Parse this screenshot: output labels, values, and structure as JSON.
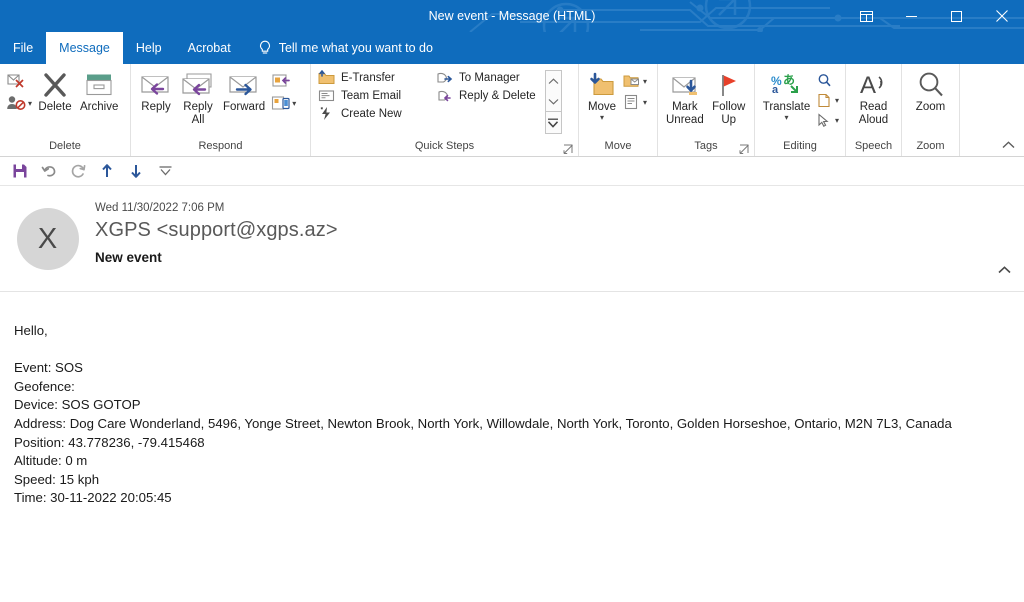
{
  "window": {
    "title": "New event  -  Message (HTML)",
    "controls": {
      "ribbon_display": "ribbon-display-options",
      "minimize": "Minimize",
      "maximize": "Maximize",
      "close": "Close"
    }
  },
  "tabs": [
    {
      "label": "File",
      "active": false
    },
    {
      "label": "Message",
      "active": true
    },
    {
      "label": "Help",
      "active": false
    },
    {
      "label": "Acrobat",
      "active": false
    }
  ],
  "tellme": {
    "label": "Tell me what you want to do",
    "icon": "lightbulb-icon"
  },
  "ribbon": {
    "collapse_icon": "chevron-up-icon",
    "groups": [
      {
        "name": "Delete",
        "label": "Delete",
        "micro": [
          {
            "label": "Ignore",
            "icon": "ignore-icon"
          },
          {
            "label": "Junk",
            "icon": "junk-icon"
          }
        ],
        "buttons": [
          {
            "label": "Delete",
            "icon": "delete-x-icon"
          },
          {
            "label": "Archive",
            "icon": "archive-icon"
          }
        ]
      },
      {
        "name": "Respond",
        "label": "Respond",
        "buttons": [
          {
            "label": "Reply",
            "icon": "reply-icon"
          },
          {
            "label": "Reply\nAll",
            "icon": "reply-all-icon"
          },
          {
            "label": "Forward",
            "icon": "forward-icon"
          }
        ],
        "stack": [
          {
            "label": "Meeting",
            "icon": "meeting-icon"
          },
          {
            "label": "More",
            "icon": "more-respond-icon"
          }
        ]
      },
      {
        "name": "Quick Steps",
        "label": "Quick Steps",
        "launcher": "dialog-launcher-icon",
        "items_col1": [
          {
            "label": "E-Transfer",
            "icon": "folder-move-icon"
          },
          {
            "label": "Team Email",
            "icon": "team-email-icon"
          },
          {
            "label": "Create New",
            "icon": "create-new-icon"
          }
        ],
        "items_col2": [
          {
            "label": "To Manager",
            "icon": "to-manager-icon"
          },
          {
            "label": "Reply & Delete",
            "icon": "reply-delete-icon"
          }
        ],
        "scroll": {
          "up": "scroll-up-icon",
          "down": "scroll-down-icon",
          "more": "quick-steps-more-icon"
        }
      },
      {
        "name": "Move",
        "label": "Move",
        "buttons": [
          {
            "label": "Move",
            "icon": "move-folder-icon"
          }
        ],
        "stack": [
          {
            "label": "Rules",
            "icon": "rules-icon"
          },
          {
            "label": "OneNote",
            "icon": "onenote-icon"
          }
        ]
      },
      {
        "name": "Tags",
        "label": "Tags",
        "launcher": "dialog-launcher-icon",
        "buttons": [
          {
            "label": "Mark\nUnread",
            "icon": "mark-unread-icon"
          },
          {
            "label": "Follow\nUp",
            "icon": "follow-up-flag-icon"
          }
        ]
      },
      {
        "name": "Editing",
        "label": "Editing",
        "buttons": [
          {
            "label": "Translate",
            "icon": "translate-icon"
          }
        ],
        "stack": [
          {
            "label": "Find",
            "icon": "find-magnifier-icon"
          },
          {
            "label": "Select All",
            "icon": "select-page-icon"
          },
          {
            "label": "Select",
            "icon": "select-pointer-icon"
          }
        ]
      },
      {
        "name": "Speech",
        "label": "Speech",
        "buttons": [
          {
            "label": "Read\nAloud",
            "icon": "read-aloud-icon"
          }
        ]
      },
      {
        "name": "Zoom",
        "label": "Zoom",
        "buttons": [
          {
            "label": "Zoom",
            "icon": "zoom-magnifier-icon"
          }
        ]
      }
    ]
  },
  "quick_access": [
    {
      "name": "save",
      "icon": "save-floppy-icon"
    },
    {
      "name": "undo",
      "icon": "undo-arrow-icon"
    },
    {
      "name": "redo",
      "icon": "redo-arrow-icon"
    },
    {
      "name": "previous-item",
      "icon": "arrow-up-icon"
    },
    {
      "name": "next-item",
      "icon": "arrow-down-icon"
    },
    {
      "name": "customize",
      "icon": "customize-qat-icon"
    }
  ],
  "message": {
    "avatar_initial": "X",
    "date": "Wed 11/30/2022 7:06 PM",
    "from": "XGPS <support@xgps.az>",
    "subject": "New event",
    "expand_icon": "chevron-up-icon",
    "body": [
      "Hello,",
      "",
      "Event: SOS",
      "Geofence:",
      "Device: SOS GOTOP",
      "Address: Dog Care Wonderland, 5496, Yonge Street, Newton Brook, North York, Willowdale, North York, Toronto, Golden Horseshoe, Ontario, M2N 7L3, Canada",
      "Position: 43.778236, -79.415468",
      "Altitude: 0 m",
      "Speed: 15 kph",
      "Time: 30-11-2022 20:05:45"
    ]
  },
  "colors": {
    "brand_blue": "#0f6cbd",
    "tab_active_text": "#0f6cbd",
    "avatar_bg": "#d6d6d6",
    "accent_purple": "#7a459c",
    "accent_blue": "#2b579a",
    "flag_red": "#e8402a",
    "archive_green": "#5a9e8a"
  }
}
